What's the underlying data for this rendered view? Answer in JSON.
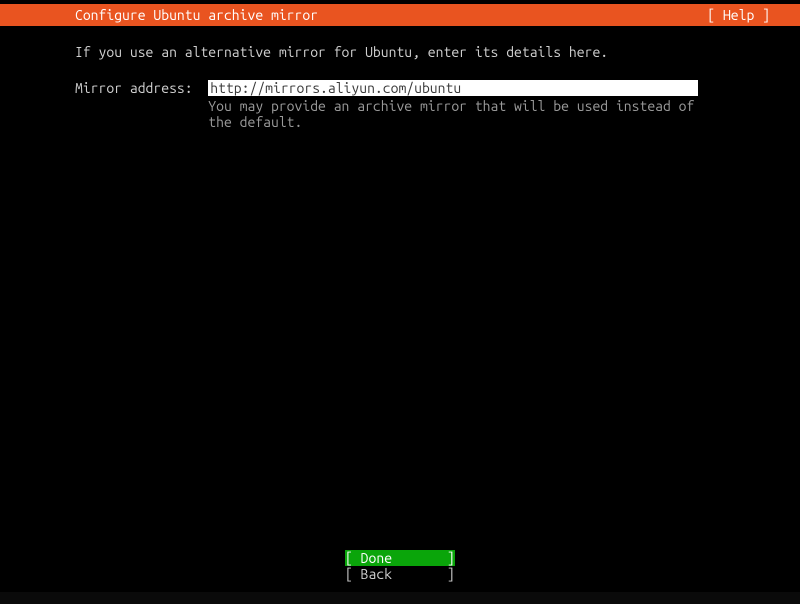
{
  "header": {
    "title": "Configure Ubuntu archive mirror",
    "help": "[ Help ]"
  },
  "content": {
    "description": "If you use an alternative mirror for Ubuntu, enter its details here.",
    "form": {
      "label": "Mirror address:  ",
      "value": "http://mirrors.aliyun.com/ubuntu",
      "help_line1": "You may provide an archive mirror that will be used instead of",
      "help_line2": "the default."
    }
  },
  "footer": {
    "done": "[ Done       ]",
    "back": "[ Back       ]"
  }
}
